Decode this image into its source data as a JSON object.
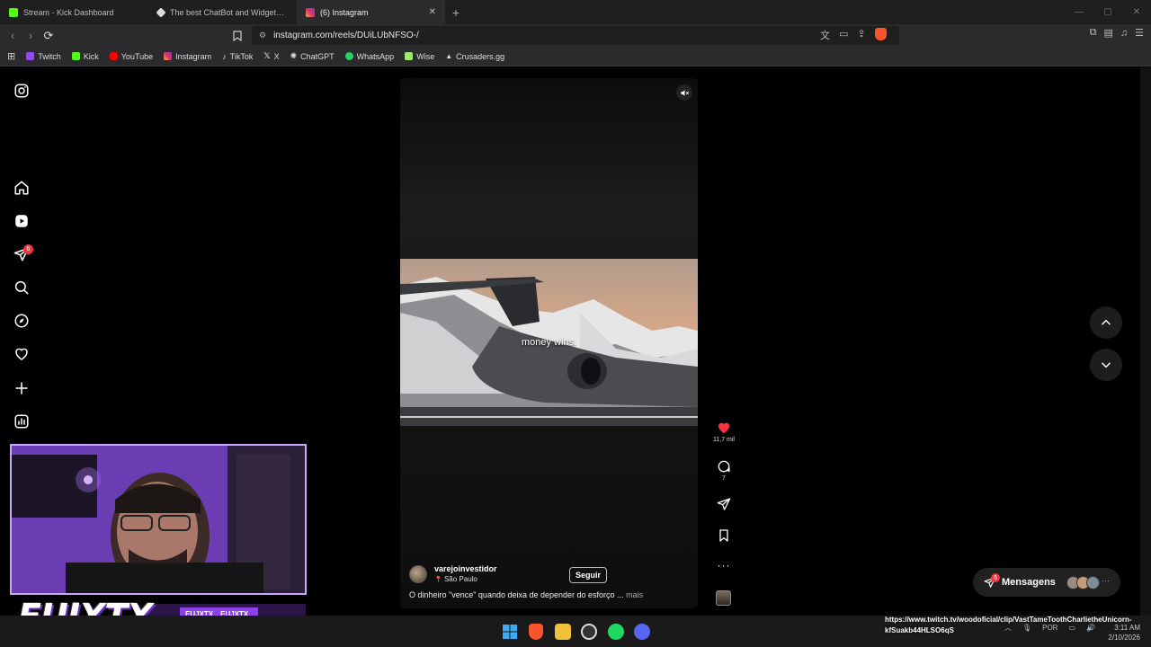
{
  "browser": {
    "tabs": [
      {
        "label": "Stream - Kick Dashboard",
        "color": "#53fc18",
        "active": false
      },
      {
        "label": "The best ChatBot and Widgets for Ki",
        "color": "#ffffff",
        "active": false
      },
      {
        "label": "(6) Instagram",
        "color": "#e1306c",
        "active": true
      }
    ],
    "new_tab": "+",
    "url": "instagram.com/reels/DUiLUbNFSO-/",
    "bookmarks": [
      {
        "label": "Twitch",
        "color": "#9146ff"
      },
      {
        "label": "Kick",
        "color": "#53fc18"
      },
      {
        "label": "YouTube",
        "color": "#ff0000"
      },
      {
        "label": "Instagram",
        "color": "#e1306c"
      },
      {
        "label": "TikTok",
        "color": "#ffffff"
      },
      {
        "label": "X",
        "color": "#ffffff"
      },
      {
        "label": "ChatGPT",
        "color": "#cfcfcf"
      },
      {
        "label": "WhatsApp",
        "color": "#25d366"
      },
      {
        "label": "Wise",
        "color": "#9fe870"
      },
      {
        "label": "Crusaders.gg",
        "color": "#ffffff"
      }
    ]
  },
  "sidebar": {
    "notification_badge": "6",
    "items": [
      "instagram-logo",
      "home-icon",
      "reels-icon",
      "messages-icon",
      "search-icon",
      "explore-icon",
      "notifications-icon",
      "create-icon",
      "dashboard-icon"
    ]
  },
  "reel": {
    "overlay_text": "money wins.",
    "author": "varejoinvestidor",
    "location": "São Paulo",
    "follow_label": "Seguir",
    "description": "O dinheiro \"vence\" quando deixa de depender do esforço ...",
    "more_label": "mais",
    "likes": "11,7 mil",
    "comments": "7",
    "liked": true,
    "like_color": "#ff3040"
  },
  "messages": {
    "label": "Mensagens",
    "badge": "6"
  },
  "stream_overlay": {
    "brand": "EUJXTX",
    "handles": [
      "EUJXTX",
      "EUJXTX_"
    ]
  },
  "toast": {
    "text": "https://www.twitch.tv/woodoficial/clip/VastTameToothCharlietheUnicorn-kfSuakb44HLSO6qS"
  },
  "taskbar": {
    "lang": "POR",
    "time": "3:11 AM",
    "date": "2/10/2026"
  }
}
